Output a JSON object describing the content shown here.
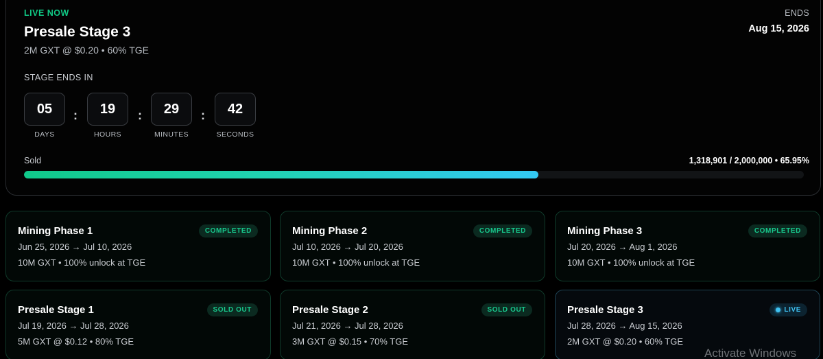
{
  "header": {
    "live_label": "LIVE NOW",
    "title": "Presale Stage 3",
    "subtitle": "2M GXT @ $0.20 • 60% TGE",
    "ends_label": "ENDS",
    "ends_date": "Aug 15, 2026"
  },
  "countdown": {
    "label": "STAGE ENDS IN",
    "days": "05",
    "days_label": "DAYS",
    "hours": "19",
    "hours_label": "HOURS",
    "minutes": "29",
    "minutes_label": "MINUTES",
    "seconds": "42",
    "seconds_label": "SECONDS",
    "separator": ":"
  },
  "progress": {
    "label": "Sold",
    "value_text": "1,318,901 / 2,000,000 • 65.95%",
    "fraction": 0.6595
  },
  "phases": [
    {
      "name": "Mining Phase 1",
      "dates": "Jun 25, 2026 → Jul 10, 2026",
      "detail": "10M GXT • 100% unlock at TGE",
      "badge": "COMPLETED"
    },
    {
      "name": "Mining Phase 2",
      "dates": "Jul 10, 2026 → Jul 20, 2026",
      "detail": "10M GXT • 100% unlock at TGE",
      "badge": "COMPLETED"
    },
    {
      "name": "Mining Phase 3",
      "dates": "Jul 20, 2026 → Aug 1, 2026",
      "detail": "10M GXT • 100% unlock at TGE",
      "badge": "COMPLETED"
    },
    {
      "name": "Presale Stage 1",
      "dates": "Jul 19, 2026 → Jul 28, 2026",
      "detail": "5M GXT @ $0.12 • 80% TGE",
      "badge": "SOLD OUT"
    },
    {
      "name": "Presale Stage 2",
      "dates": "Jul 21, 2026 → Jul 28, 2026",
      "detail": "3M GXT @ $0.15 • 70% TGE",
      "badge": "SOLD OUT"
    },
    {
      "name": "Presale Stage 3",
      "dates": "Jul 28, 2026 → Aug 15, 2026",
      "detail": "2M GXT @ $0.20 • 60% TGE",
      "badge": "LIVE"
    }
  ],
  "colors": {
    "accent_green": "#10c985",
    "accent_cyan": "#33c9f5",
    "background": "#000000"
  },
  "watermark": "Activate Windows"
}
